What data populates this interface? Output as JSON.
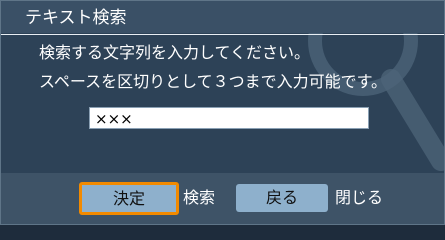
{
  "dialog": {
    "title": "テキスト検索",
    "instruction_line1": "検索する文字列を入力してください。",
    "instruction_line2": "スペースを区切りとして３つまで入力可能です。",
    "background_icon": "magnifier-icon"
  },
  "search": {
    "value": "×××"
  },
  "footer": {
    "ok_button_label": "決定",
    "ok_action_label": "検索",
    "back_button_label": "戻る",
    "back_action_label": "閉じる"
  },
  "colors": {
    "background": "#2d4257",
    "title_bar": "#3a5066",
    "button": "#8eb0cc",
    "focus": "#f28a00"
  }
}
